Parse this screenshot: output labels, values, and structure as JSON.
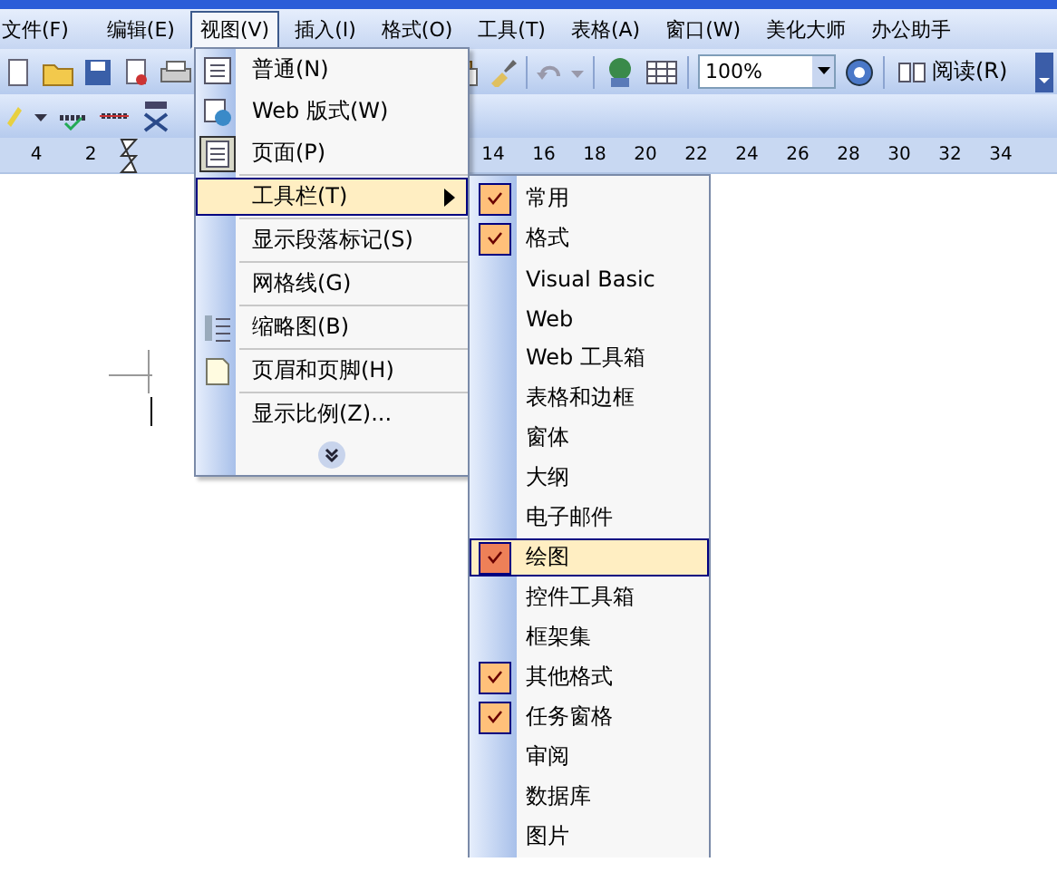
{
  "menu_bar": [
    {
      "label": "文件(F)",
      "selected": false
    },
    {
      "label": "编辑(E)",
      "selected": false
    },
    {
      "label": "视图(V)",
      "selected": true
    },
    {
      "label": "插入(I)",
      "selected": false
    },
    {
      "label": "格式(O)",
      "selected": false
    },
    {
      "label": "工具(T)",
      "selected": false
    },
    {
      "label": "表格(A)",
      "selected": false
    },
    {
      "label": "窗口(W)",
      "selected": false
    },
    {
      "label": "美化大师",
      "selected": false
    },
    {
      "label": "办公助手",
      "selected": false
    }
  ],
  "toolbar": {
    "zoom": "100%",
    "read_button": "阅读(R)"
  },
  "ruler": {
    "left_numbers": [
      "4",
      "2"
    ],
    "numbers": [
      "14",
      "16",
      "18",
      "20",
      "22",
      "24",
      "26",
      "28",
      "30",
      "32",
      "34"
    ]
  },
  "view_menu": {
    "items": [
      {
        "label": "普通(N)",
        "selected": false,
        "submenu": false,
        "separator_above": false
      },
      {
        "label": "Web 版式(W)",
        "selected": false,
        "submenu": false,
        "separator_above": false
      },
      {
        "label": "页面(P)",
        "selected": false,
        "submenu": false,
        "separator_above": false
      },
      {
        "label": "工具栏(T)",
        "selected": true,
        "submenu": true,
        "separator_above": true
      },
      {
        "label": "显示段落标记(S)",
        "selected": false,
        "submenu": false,
        "separator_above": true
      },
      {
        "label": "网格线(G)",
        "selected": false,
        "submenu": false,
        "separator_above": true
      },
      {
        "label": "缩略图(B)",
        "selected": false,
        "submenu": false,
        "separator_above": true
      },
      {
        "label": "页眉和页脚(H)",
        "selected": false,
        "submenu": false,
        "separator_above": true
      },
      {
        "label": "显示比例(Z)...",
        "selected": false,
        "submenu": false,
        "separator_above": true
      }
    ]
  },
  "toolbars_submenu": {
    "items": [
      {
        "label": "常用",
        "checked": true,
        "selected": false
      },
      {
        "label": "格式",
        "checked": true,
        "selected": false
      },
      {
        "label": "Visual Basic",
        "checked": false,
        "selected": false
      },
      {
        "label": "Web",
        "checked": false,
        "selected": false
      },
      {
        "label": "Web 工具箱",
        "checked": false,
        "selected": false
      },
      {
        "label": "表格和边框",
        "checked": false,
        "selected": false
      },
      {
        "label": "窗体",
        "checked": false,
        "selected": false
      },
      {
        "label": "大纲",
        "checked": false,
        "selected": false
      },
      {
        "label": "电子邮件",
        "checked": false,
        "selected": false
      },
      {
        "label": "绘图",
        "checked": true,
        "selected": true
      },
      {
        "label": "控件工具箱",
        "checked": false,
        "selected": false
      },
      {
        "label": "框架集",
        "checked": false,
        "selected": false
      },
      {
        "label": "其他格式",
        "checked": true,
        "selected": false
      },
      {
        "label": "任务窗格",
        "checked": true,
        "selected": false
      },
      {
        "label": "审阅",
        "checked": false,
        "selected": false
      },
      {
        "label": "数据库",
        "checked": false,
        "selected": false
      },
      {
        "label": "图片",
        "checked": false,
        "selected": false
      }
    ]
  }
}
